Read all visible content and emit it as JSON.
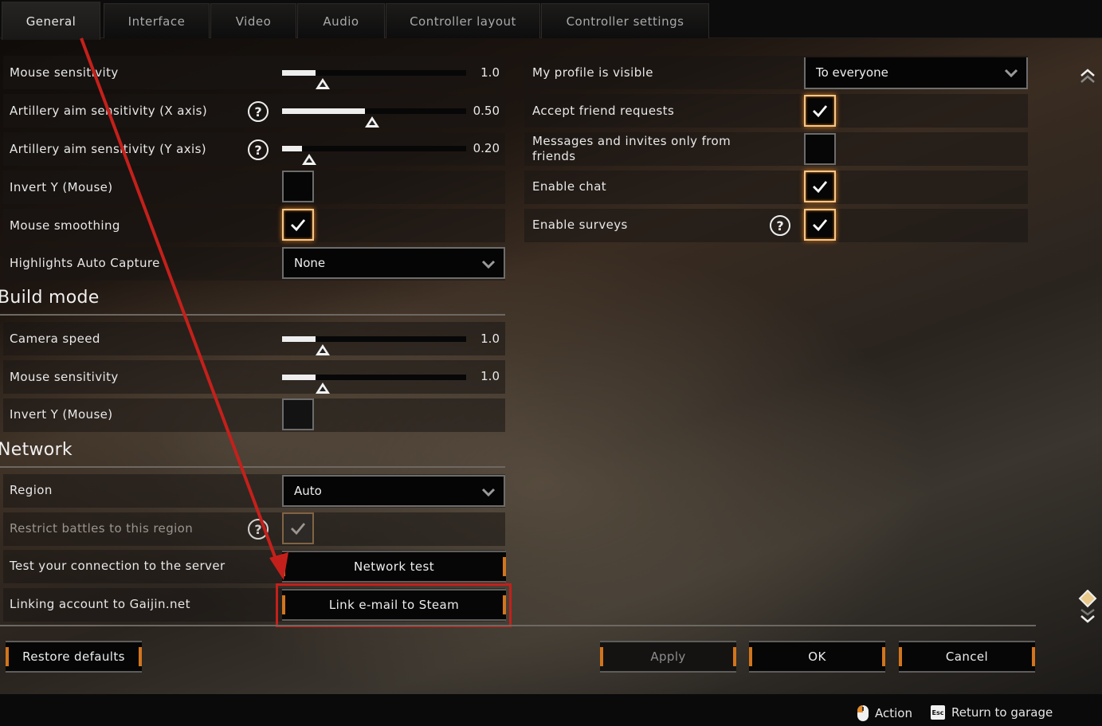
{
  "tabs": [
    {
      "label": "General",
      "active": true
    },
    {
      "label": "Interface",
      "active": false
    },
    {
      "label": "Video",
      "active": false
    },
    {
      "label": "Audio",
      "active": false
    },
    {
      "label": "Controller layout",
      "active": false
    },
    {
      "label": "Controller settings",
      "active": false
    }
  ],
  "left": {
    "mouse_sensitivity": {
      "label": "Mouse sensitivity",
      "value": "1.0",
      "fraction": 0.18
    },
    "artillery_x": {
      "label": "Artillery aim sensitivity (X axis)",
      "value": "0.50",
      "fraction": 0.45
    },
    "artillery_y": {
      "label": "Artillery aim sensitivity (Y axis)",
      "value": "0.20",
      "fraction": 0.11
    },
    "invert_y": {
      "label": "Invert Y (Mouse)",
      "checked": false
    },
    "mouse_smoothing": {
      "label": "Mouse smoothing",
      "checked": true
    },
    "highlights": {
      "label": "Highlights Auto Capture",
      "value": "None"
    }
  },
  "build_mode": {
    "title": "Build mode",
    "camera_speed": {
      "label": "Camera speed",
      "value": "1.0",
      "fraction": 0.18
    },
    "mouse_sensitivity": {
      "label": "Mouse sensitivity",
      "value": "1.0",
      "fraction": 0.18
    },
    "invert_y": {
      "label": "Invert Y (Mouse)",
      "checked": false
    }
  },
  "network": {
    "title": "Network",
    "region": {
      "label": "Region",
      "value": "Auto"
    },
    "restrict": {
      "label": "Restrict battles to this region",
      "checked": true,
      "disabled": true
    },
    "test": {
      "label": "Test your connection to the server",
      "button": "Network test"
    },
    "linking": {
      "label": "Linking account to Gaijin.net",
      "button": "Link e-mail to Steam"
    }
  },
  "right": {
    "profile_visible": {
      "label": "My profile is visible",
      "value": "To everyone"
    },
    "accept_friends": {
      "label": "Accept friend requests",
      "checked": true
    },
    "messages_friends": {
      "label": "Messages and invites only from friends",
      "checked": false
    },
    "enable_chat": {
      "label": "Enable chat",
      "checked": true
    },
    "enable_surveys": {
      "label": "Enable surveys",
      "checked": true
    }
  },
  "buttons": {
    "restore": "Restore defaults",
    "apply": "Apply",
    "ok": "OK",
    "cancel": "Cancel"
  },
  "footer": {
    "action": "Action",
    "esc_key": "Esc",
    "return": "Return to garage"
  },
  "help_glyph": "?",
  "colors": {
    "accent": "#d2751c",
    "annotation": "#c4201b"
  }
}
